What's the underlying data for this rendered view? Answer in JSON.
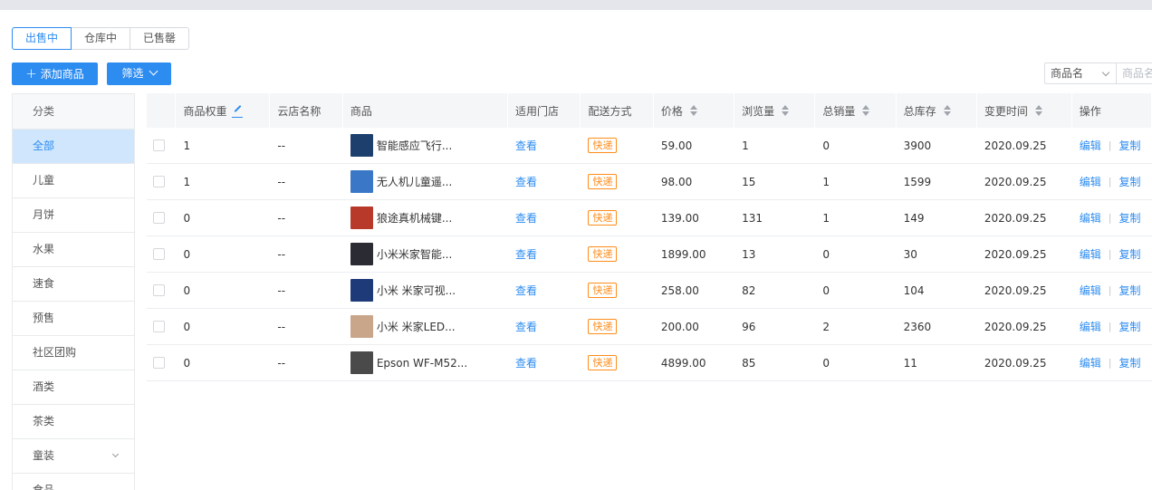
{
  "status_tabs": [
    {
      "label": "出售中",
      "active": true
    },
    {
      "label": "仓库中",
      "active": false
    },
    {
      "label": "已售罄",
      "active": false
    }
  ],
  "toolbar": {
    "add_label": "添加商品",
    "filter_label": "筛选"
  },
  "search": {
    "field_select": "商品名",
    "placeholder": "商品名"
  },
  "sidebar": {
    "header": "分类",
    "items": [
      {
        "label": "全部",
        "active": true
      },
      {
        "label": "儿童"
      },
      {
        "label": "月饼"
      },
      {
        "label": "水果"
      },
      {
        "label": "速食"
      },
      {
        "label": "预售"
      },
      {
        "label": "社区团购"
      },
      {
        "label": "酒类"
      },
      {
        "label": "茶类"
      },
      {
        "label": "童装",
        "expandable": true
      },
      {
        "label": "食品"
      }
    ]
  },
  "table": {
    "headers": {
      "weight": "商品权重",
      "cloud": "云店名称",
      "product": "商品",
      "store": "适用门店",
      "ship": "配送方式",
      "price": "价格",
      "views": "浏览量",
      "sales": "总销量",
      "stock": "总库存",
      "time": "变更时间",
      "ops": "操作"
    },
    "rows": [
      {
        "weight": "1",
        "cloud": "--",
        "name": "智能感应飞行...",
        "store": "查看",
        "ship": "快递",
        "price": "59.00",
        "views": "1",
        "sales": "0",
        "stock": "3900",
        "time": "2020.09.25",
        "edit": "编辑",
        "copy": "复制",
        "thumb_color": "#1c3f6e"
      },
      {
        "weight": "1",
        "cloud": "--",
        "name": "无人机儿童遥...",
        "store": "查看",
        "ship": "快递",
        "price": "98.00",
        "views": "15",
        "sales": "1",
        "stock": "1599",
        "time": "2020.09.25",
        "edit": "编辑",
        "copy": "复制",
        "thumb_color": "#3a78c7"
      },
      {
        "weight": "0",
        "cloud": "--",
        "name": "狼途真机械键...",
        "store": "查看",
        "ship": "快递",
        "price": "139.00",
        "views": "131",
        "sales": "1",
        "stock": "149",
        "time": "2020.09.25",
        "edit": "编辑",
        "copy": "复制",
        "thumb_color": "#b8392a"
      },
      {
        "weight": "0",
        "cloud": "--",
        "name": "小米米家智能...",
        "store": "查看",
        "ship": "快递",
        "price": "1899.00",
        "views": "13",
        "sales": "0",
        "stock": "30",
        "time": "2020.09.25",
        "edit": "编辑",
        "copy": "复制",
        "thumb_color": "#2b2b33"
      },
      {
        "weight": "0",
        "cloud": "--",
        "name": "小米 米家可视...",
        "store": "查看",
        "ship": "快递",
        "price": "258.00",
        "views": "82",
        "sales": "0",
        "stock": "104",
        "time": "2020.09.25",
        "edit": "编辑",
        "copy": "复制",
        "thumb_color": "#1f3a78"
      },
      {
        "weight": "0",
        "cloud": "--",
        "name": "小米 米家LED...",
        "store": "查看",
        "ship": "快递",
        "price": "200.00",
        "views": "96",
        "sales": "2",
        "stock": "2360",
        "time": "2020.09.25",
        "edit": "编辑",
        "copy": "复制",
        "thumb_color": "#c9a58a"
      },
      {
        "weight": "0",
        "cloud": "--",
        "name": "Epson WF-M52...",
        "store": "查看",
        "ship": "快递",
        "price": "4899.00",
        "views": "85",
        "sales": "0",
        "stock": "11",
        "time": "2020.09.25",
        "edit": "编辑",
        "copy": "复制",
        "thumb_color": "#4a4a4a"
      }
    ]
  }
}
